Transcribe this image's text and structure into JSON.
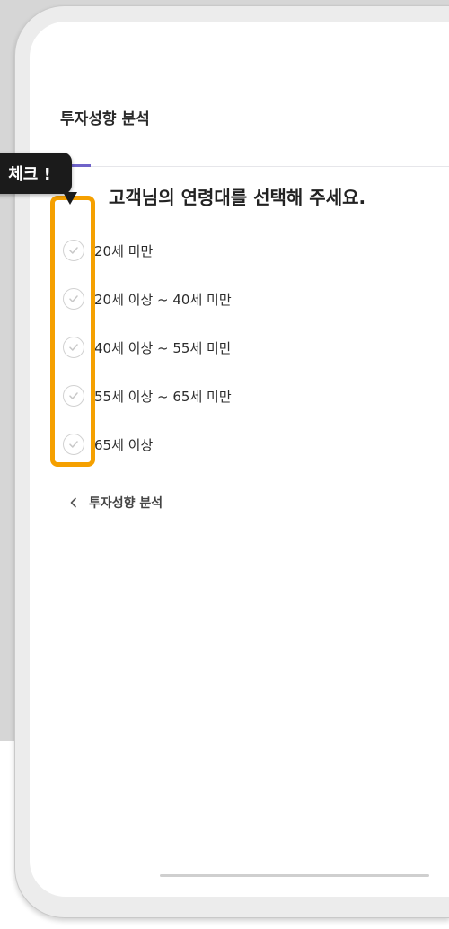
{
  "header": {
    "title": "투자성향 분석"
  },
  "question": "고객님의 연령대를 선택해 주세요.",
  "options": [
    {
      "label": "20세 미만",
      "checked": false
    },
    {
      "label": "20세 이상 ~ 40세 미만",
      "checked": false
    },
    {
      "label": "40세 이상 ~ 55세 미만",
      "checked": false
    },
    {
      "label": "55세 이상 ~ 65세 미만",
      "checked": false
    },
    {
      "label": "65세 이상",
      "checked": false
    }
  ],
  "back_link": {
    "label": "투자성향 분석",
    "icon": "chevron-left-icon"
  },
  "callout": {
    "text": "체크 !"
  },
  "colors": {
    "accent": "#6f63c9",
    "highlight": "#f5a000",
    "callout_bg": "#1b1b1b",
    "check_icon": "#c8c8c8"
  }
}
